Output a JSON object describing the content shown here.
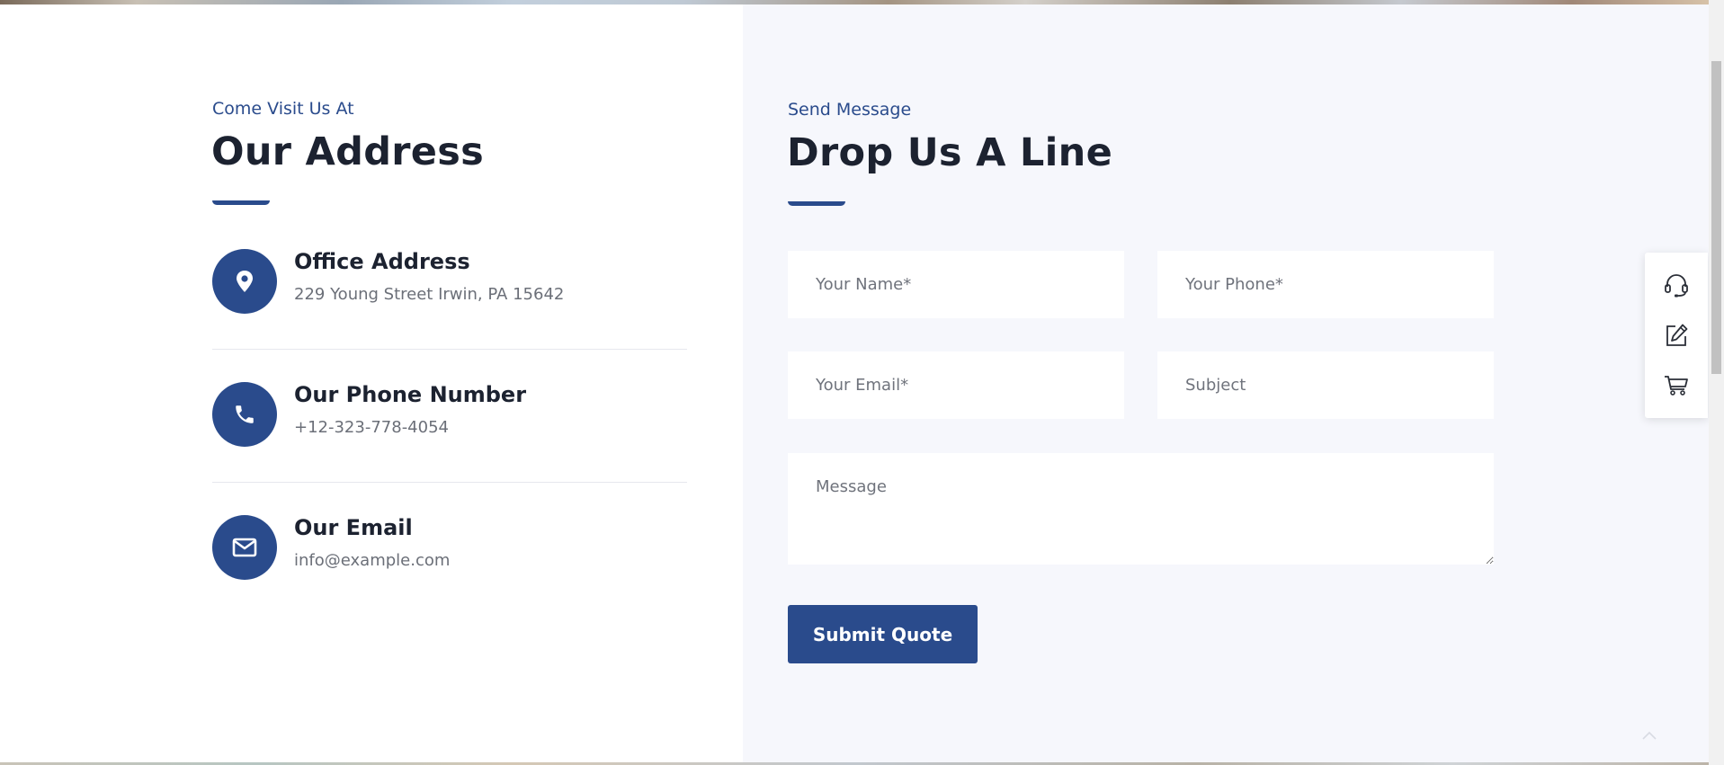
{
  "address_section": {
    "eyebrow": "Come Visit Us At",
    "heading": "Our Address",
    "items": [
      {
        "icon": "location-pin-icon",
        "title": "Office Address",
        "value": "229 Young Street Irwin, PA 15642"
      },
      {
        "icon": "phone-icon",
        "title": "Our Phone Number",
        "value": "+12-323-778-4054"
      },
      {
        "icon": "envelope-icon",
        "title": "Our Email",
        "value": "info@example.com"
      }
    ]
  },
  "contact_form": {
    "eyebrow": "Send Message",
    "heading": "Drop Us A Line",
    "fields": {
      "name": {
        "placeholder": "Your Name*",
        "value": ""
      },
      "phone": {
        "placeholder": "Your Phone*",
        "value": ""
      },
      "email": {
        "placeholder": "Your Email*",
        "value": ""
      },
      "subject": {
        "placeholder": "Subject",
        "value": ""
      },
      "message": {
        "placeholder": "Message",
        "value": ""
      }
    },
    "submit_label": "Submit Quote"
  },
  "side_panel": {
    "icons": [
      "headset-icon",
      "edit-icon",
      "cart-icon"
    ]
  },
  "colors": {
    "accent": "#2a4b8c",
    "heading": "#1c2230",
    "muted_text": "#6b6f78",
    "form_background": "#f6f7fc"
  }
}
